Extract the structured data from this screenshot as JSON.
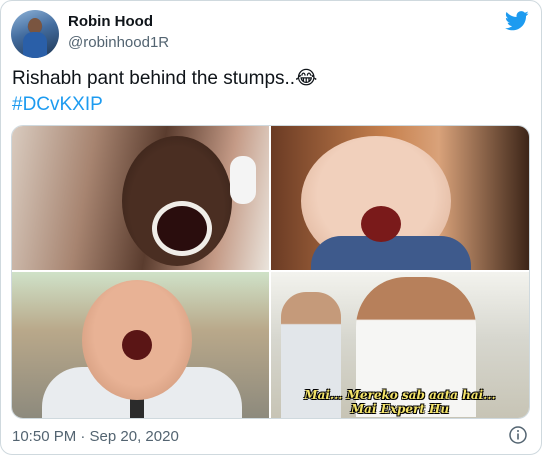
{
  "tweet": {
    "display_name": "Robin Hood",
    "handle": "@robinhood1R",
    "text": "Rishabh pant behind the stumps..😂",
    "hashtag": "#DCvKXIP",
    "timestamp": "10:50 PM · Sep 20, 2020"
  },
  "media": {
    "subtitle_line1": "Mai... Mereko sab aata hai...",
    "subtitle_line2": "Mai Expert Hu"
  },
  "colors": {
    "link": "#1d9bf0",
    "secondary_text": "#536471",
    "twitter_blue": "#1d9bf0"
  },
  "icons": [
    "twitter-bird-icon",
    "info-icon"
  ]
}
